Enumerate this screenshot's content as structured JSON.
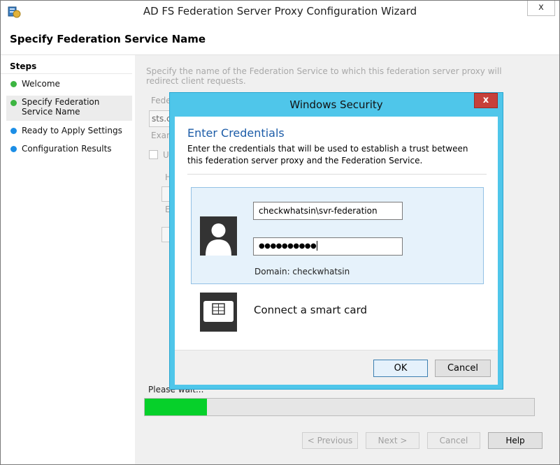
{
  "window": {
    "title": "AD FS Federation Server Proxy Configuration Wizard",
    "close_label": "x"
  },
  "header": {
    "title": "Specify Federation Service Name"
  },
  "steps": {
    "heading": "Steps",
    "items": [
      {
        "label": "Welcome",
        "status_color": "#3cb541"
      },
      {
        "label": "Specify Federation Service Name",
        "status_color": "#3cb541"
      },
      {
        "label": "Ready to Apply Settings",
        "status_color": "#1c8ee6"
      },
      {
        "label": "Configuration Results",
        "status_color": "#1c8ee6"
      }
    ]
  },
  "content": {
    "description": "Specify the name of the Federation Service to which this federation server proxy will redirect  client requests.",
    "fragments": {
      "fed_label": "Feder",
      "fed_value": "sts.cl",
      "example": "Exam",
      "check_frag": "U",
      "h_frag": "H",
      "e_frag": "E"
    },
    "please_wait": "Please wait...",
    "progress": 0.16
  },
  "buttons": {
    "previous": "< Previous",
    "next": "Next >",
    "cancel": "Cancel",
    "help": "Help"
  },
  "dialog": {
    "title": "Windows Security",
    "close_label": "x",
    "heading": "Enter Credentials",
    "description": "Enter the credentials that will be used to establish a trust between this federation server proxy and the Federation Service.",
    "username": "checkwhatsin\\svr-federation",
    "password_mask": "●●●●●●●●●●",
    "domain": "Domain: checkwhatsin",
    "smart_card_label": "Connect a smart card",
    "ok": "OK",
    "cancel": "Cancel",
    "accent_color": "#4fc6ea"
  }
}
